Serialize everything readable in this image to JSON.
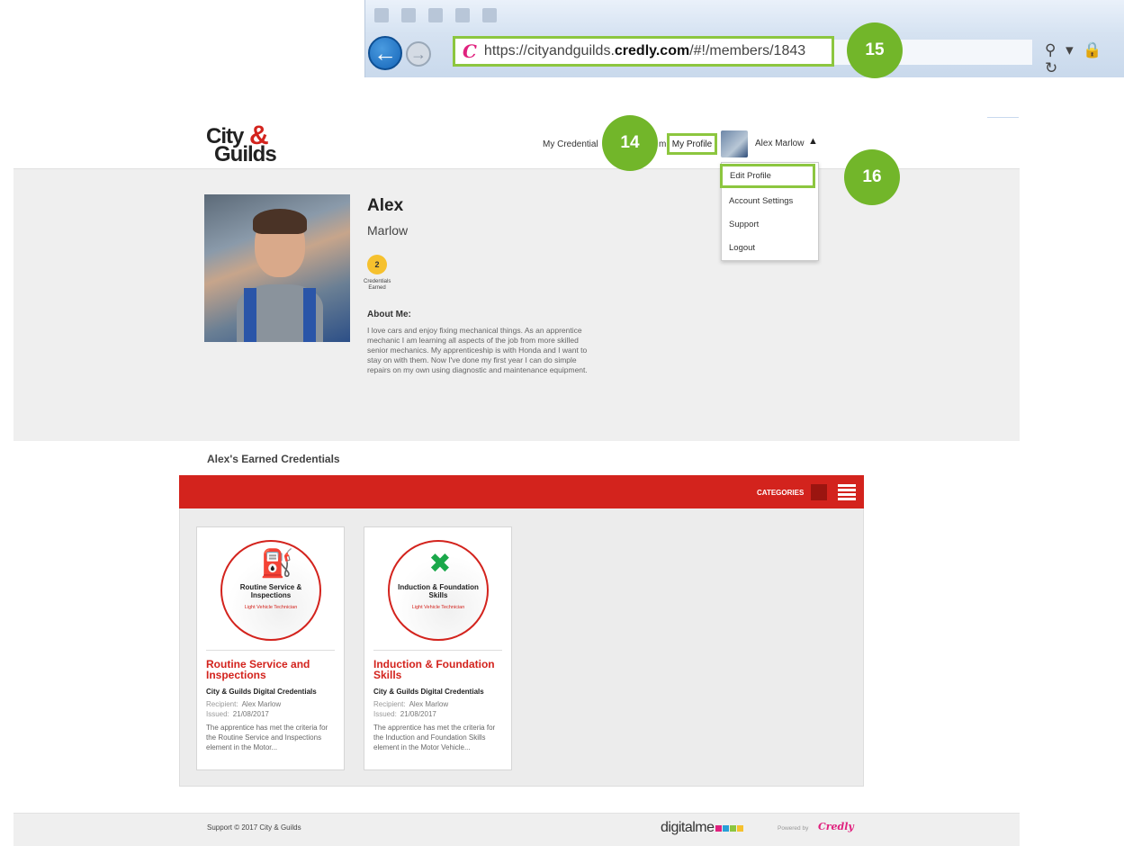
{
  "browser": {
    "url_prefix": "https://cityandguilds.",
    "url_domain": "credly.com",
    "url_path": "/#!/members/1843",
    "credly_logo": "C",
    "back_glyph": "←",
    "forward_glyph": "→",
    "right_icons": "⚲ ▾ 🔒 ↻"
  },
  "callouts": {
    "c14": "14",
    "c15": "15",
    "c16": "16"
  },
  "header": {
    "logo_city": "City",
    "logo_amp": "&",
    "logo_guilds": "Guilds",
    "nav_my_credentials": "My Credential",
    "nav_hidden_fragment": "m",
    "nav_my_profile": "My Profile",
    "user_name": "Alex Marlow",
    "caret": "▲"
  },
  "dropdown": {
    "items": [
      "Edit Profile",
      "Account Settings",
      "Support",
      "Logout"
    ]
  },
  "profile": {
    "first_name": "Alex",
    "last_name": "Marlow",
    "credentials_count": "2",
    "credentials_label": "Credentials Earned",
    "about_heading": "About Me:",
    "about_text": "I love cars and enjoy fixing mechanical things. As an apprentice mechanic I am learning all aspects of the job from more skilled senior mechanics. My apprenticeship is with Honda and I want to stay on with them. Now I've done my first year I can do simple repairs on my own using diagnostic and maintenance equipment."
  },
  "credentials_section": {
    "title": "Alex's Earned Credentials",
    "categories_label": "CATEGORIES",
    "cards": [
      {
        "badge_icon": "⛽",
        "badge_name": "Routine Service & Inspections",
        "badge_sub": "Light Vehicle Technician",
        "title": "Routine Service and Inspections",
        "issuer": "City & Guilds Digital Credentials",
        "recipient_label": "Recipient:",
        "recipient": "Alex Marlow",
        "issued_label": "Issued:",
        "issued": "21/08/2017",
        "description": "The apprentice has met the criteria for the Routine Service and Inspections element in the Motor..."
      },
      {
        "badge_icon": "✖",
        "badge_name": "Induction & Foundation Skills",
        "badge_sub": "Light Vehicle Technician",
        "title": "Induction & Foundation Skills",
        "issuer": "City & Guilds Digital Credentials",
        "recipient_label": "Recipient:",
        "recipient": "Alex Marlow",
        "issued_label": "Issued:",
        "issued": "21/08/2017",
        "description": "The apprentice has met the criteria for the Induction and Foundation Skills element in the Motor Vehicle..."
      }
    ]
  },
  "footer": {
    "left": "Support   © 2017 City & Guilds",
    "digitalme": "digitalme",
    "powered_by": "Powered by",
    "credly": "Credly"
  },
  "colors": {
    "accent_red": "#d3231d",
    "callout_green": "#72b62a",
    "highlight_green": "#8cc63f",
    "badge_green": "#1aa84a"
  }
}
